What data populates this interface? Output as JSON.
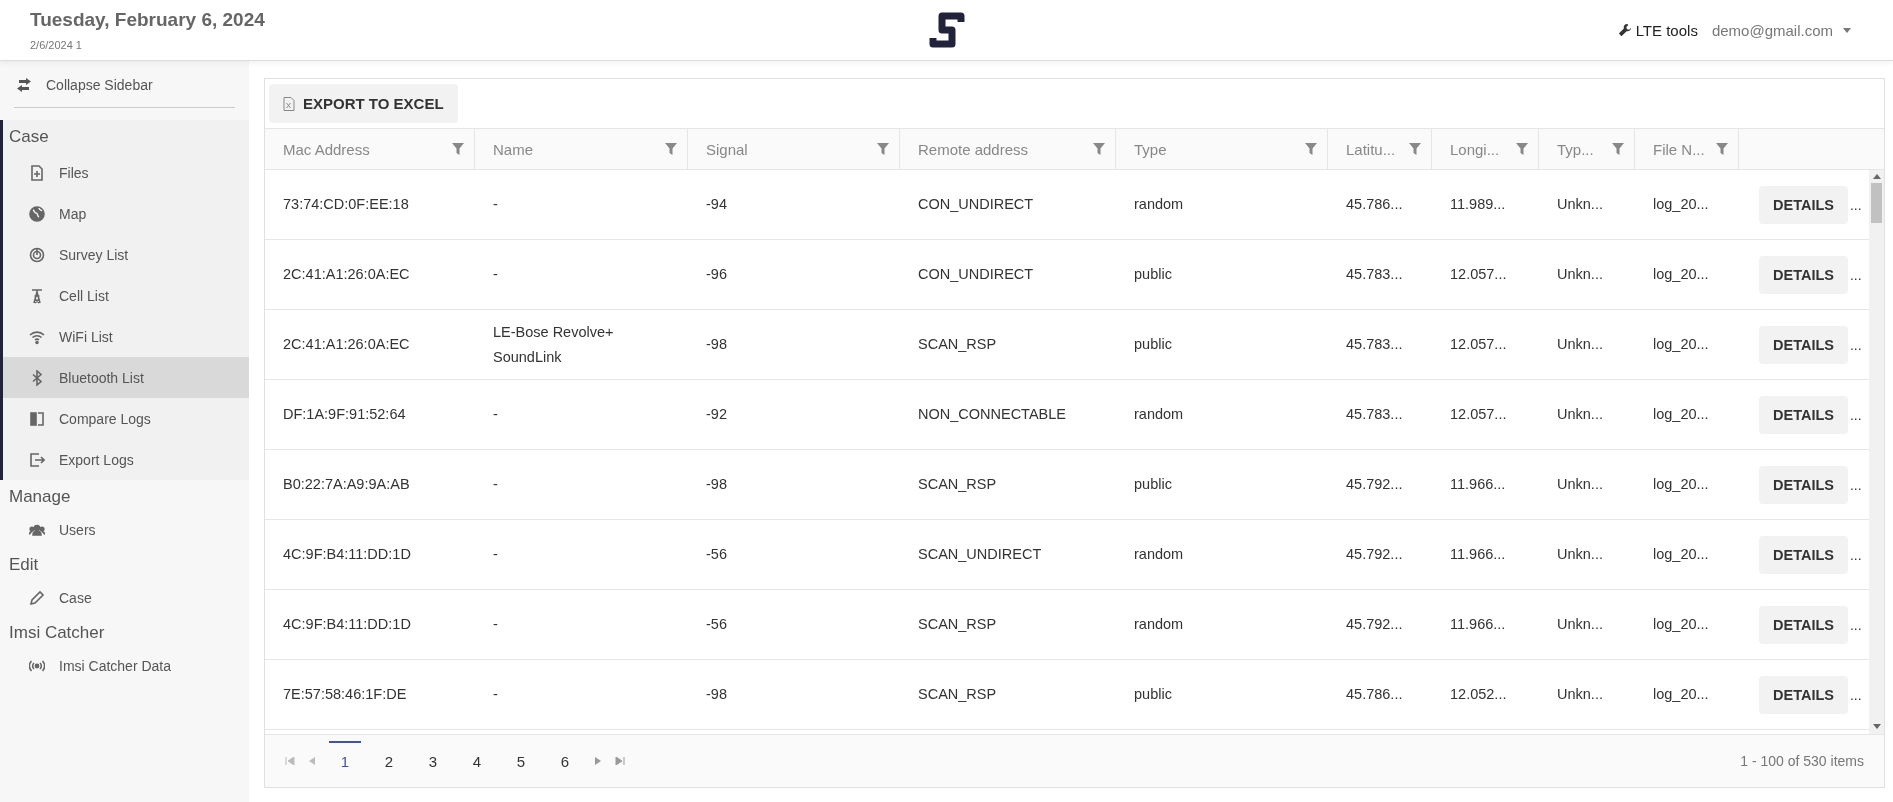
{
  "header": {
    "date": "Tuesday, February 6, 2024",
    "subtitle": "2/6/2024 1",
    "tools_link": "LTE tools",
    "user": "demo@gmail.com"
  },
  "sidebar": {
    "collapse_label": "Collapse Sidebar",
    "sections": [
      {
        "title": "Case",
        "active": true,
        "items": [
          {
            "label": "Files",
            "selected": false
          },
          {
            "label": "Map",
            "selected": false
          },
          {
            "label": "Survey List",
            "selected": false
          },
          {
            "label": "Cell List",
            "selected": false
          },
          {
            "label": "WiFi List",
            "selected": false
          },
          {
            "label": "Bluetooth List",
            "selected": true
          },
          {
            "label": "Compare Logs",
            "selected": false
          },
          {
            "label": "Export Logs",
            "selected": false
          }
        ]
      },
      {
        "title": "Manage",
        "active": false,
        "items": [
          {
            "label": "Users",
            "selected": false
          }
        ]
      },
      {
        "title": "Edit",
        "active": false,
        "items": [
          {
            "label": "Case",
            "selected": false
          }
        ]
      },
      {
        "title": "Imsi Catcher",
        "active": false,
        "items": [
          {
            "label": "Imsi Catcher Data",
            "selected": false
          }
        ]
      }
    ]
  },
  "toolbar": {
    "export_button": "EXPORT TO EXCEL"
  },
  "table": {
    "columns": [
      "Mac Address",
      "Name",
      "Signal",
      "Remote address",
      "Type",
      "Latitu...",
      "Longi...",
      "Typ...",
      "File N..."
    ],
    "rows": [
      {
        "cells": [
          "73:74:CD:0F:EE:18",
          "-",
          "-94",
          "CON_UNDIRECT",
          "random",
          "45.786...",
          "11.989...",
          "Unkn...",
          "log_20..."
        ],
        "action": "DETAILS",
        "overflow": "..."
      },
      {
        "cells": [
          "2C:41:A1:26:0A:EC",
          "-",
          "-96",
          "CON_UNDIRECT",
          "public",
          "45.783...",
          "12.057...",
          "Unkn...",
          "log_20..."
        ],
        "action": "DETAILS",
        "overflow": "..."
      },
      {
        "cells": [
          "2C:41:A1:26:0A:EC",
          "LE-Bose Revolve+ SoundLink",
          "-98",
          "SCAN_RSP",
          "public",
          "45.783...",
          "12.057...",
          "Unkn...",
          "log_20..."
        ],
        "action": "DETAILS",
        "overflow": "..."
      },
      {
        "cells": [
          "DF:1A:9F:91:52:64",
          "-",
          "-92",
          "NON_CONNECTABLE",
          "random",
          "45.783...",
          "12.057...",
          "Unkn...",
          "log_20..."
        ],
        "action": "DETAILS",
        "overflow": "..."
      },
      {
        "cells": [
          "B0:22:7A:A9:9A:AB",
          "-",
          "-98",
          "SCAN_RSP",
          "public",
          "45.792...",
          "11.966...",
          "Unkn...",
          "log_20..."
        ],
        "action": "DETAILS",
        "overflow": "..."
      },
      {
        "cells": [
          "4C:9F:B4:11:DD:1D",
          "-",
          "-56",
          "SCAN_UNDIRECT",
          "random",
          "45.792...",
          "11.966...",
          "Unkn...",
          "log_20..."
        ],
        "action": "DETAILS",
        "overflow": "..."
      },
      {
        "cells": [
          "4C:9F:B4:11:DD:1D",
          "-",
          "-56",
          "SCAN_RSP",
          "random",
          "45.792...",
          "11.966...",
          "Unkn...",
          "log_20..."
        ],
        "action": "DETAILS",
        "overflow": "..."
      },
      {
        "cells": [
          "7E:57:58:46:1F:DE",
          "-",
          "-98",
          "SCAN_RSP",
          "public",
          "45.786...",
          "12.052...",
          "Unkn...",
          "log_20..."
        ],
        "action": "DETAILS",
        "overflow": "..."
      }
    ]
  },
  "pagination": {
    "pages": [
      {
        "label": "1",
        "selected": true
      },
      {
        "label": "2",
        "selected": false
      },
      {
        "label": "3",
        "selected": false
      },
      {
        "label": "4",
        "selected": false
      },
      {
        "label": "5",
        "selected": false
      },
      {
        "label": "6",
        "selected": false
      }
    ],
    "info": "1 - 100 of 530 items"
  }
}
